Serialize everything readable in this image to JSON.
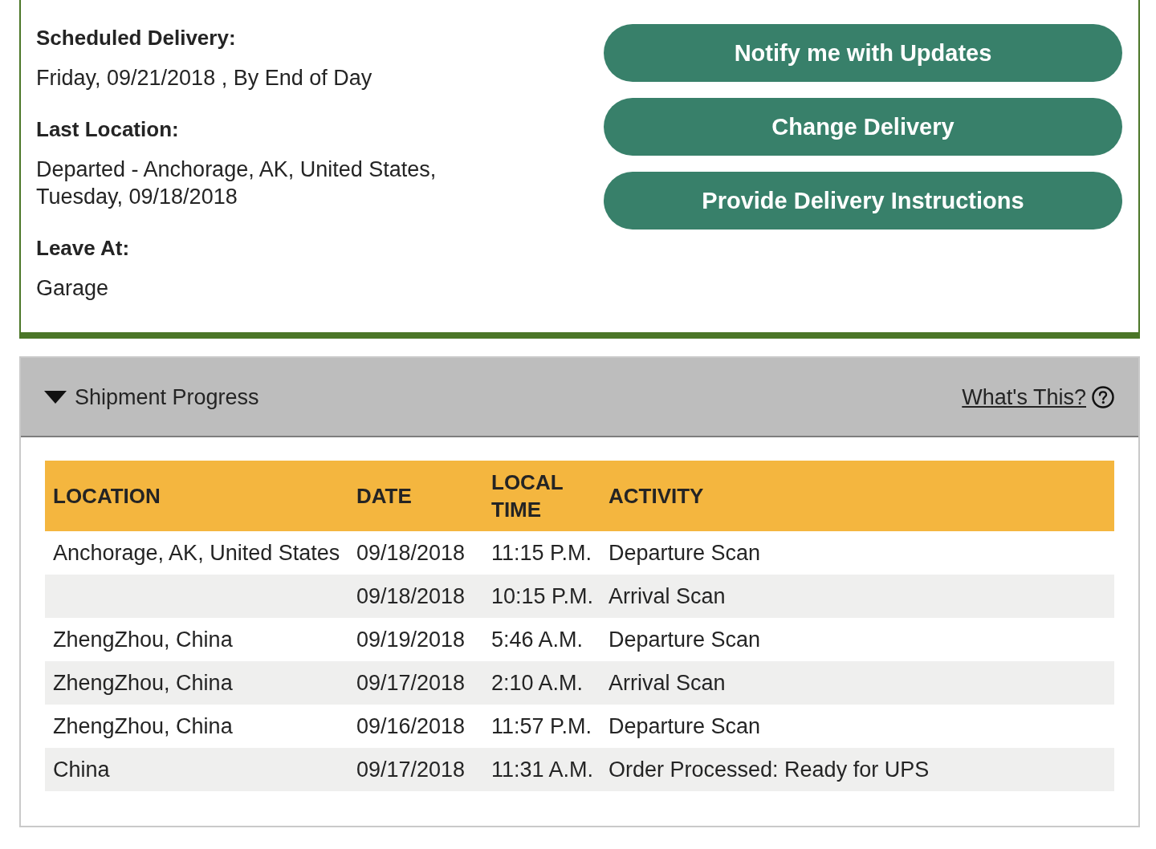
{
  "delivery_details": {
    "sections": [
      {
        "label": "Scheduled Delivery:",
        "lines": [
          "Friday, 09/21/2018 , By End of Day"
        ]
      },
      {
        "label": "Last Location:",
        "lines": [
          "Departed - Anchorage, AK, United States,",
          "Tuesday, 09/18/2018"
        ]
      },
      {
        "label": "Leave At:",
        "lines": [
          "Garage"
        ]
      }
    ],
    "buttons": [
      "Notify me with Updates",
      "Change Delivery",
      "Provide Delivery Instructions"
    ]
  },
  "shipment_progress": {
    "title": "Shipment Progress",
    "expanded": true,
    "help_link": "What's This?",
    "table": {
      "columns": [
        "LOCATION",
        "DATE",
        "LOCAL TIME",
        "ACTIVITY"
      ],
      "rows": [
        {
          "location": "Anchorage, AK, United States",
          "date": "09/18/2018",
          "local_time": "11:15 P.M.",
          "activity": "Departure Scan"
        },
        {
          "date": "09/18/2018",
          "local_time": "10:15 P.M.",
          "activity": "Arrival Scan"
        },
        {
          "location": "ZhengZhou, China",
          "date": "09/19/2018",
          "local_time": "5:46 A.M.",
          "activity": "Departure Scan"
        },
        {
          "location": "ZhengZhou, China",
          "date": "09/17/2018",
          "local_time": "2:10 A.M.",
          "activity": "Arrival Scan"
        },
        {
          "location": "ZhengZhou, China",
          "date": "09/16/2018",
          "local_time": "11:57 P.M.",
          "activity": "Departure Scan"
        },
        {
          "location": "China",
          "date": "09/17/2018",
          "local_time": "11:31 A.M.",
          "activity": "Order Processed: Ready for UPS"
        }
      ]
    }
  }
}
